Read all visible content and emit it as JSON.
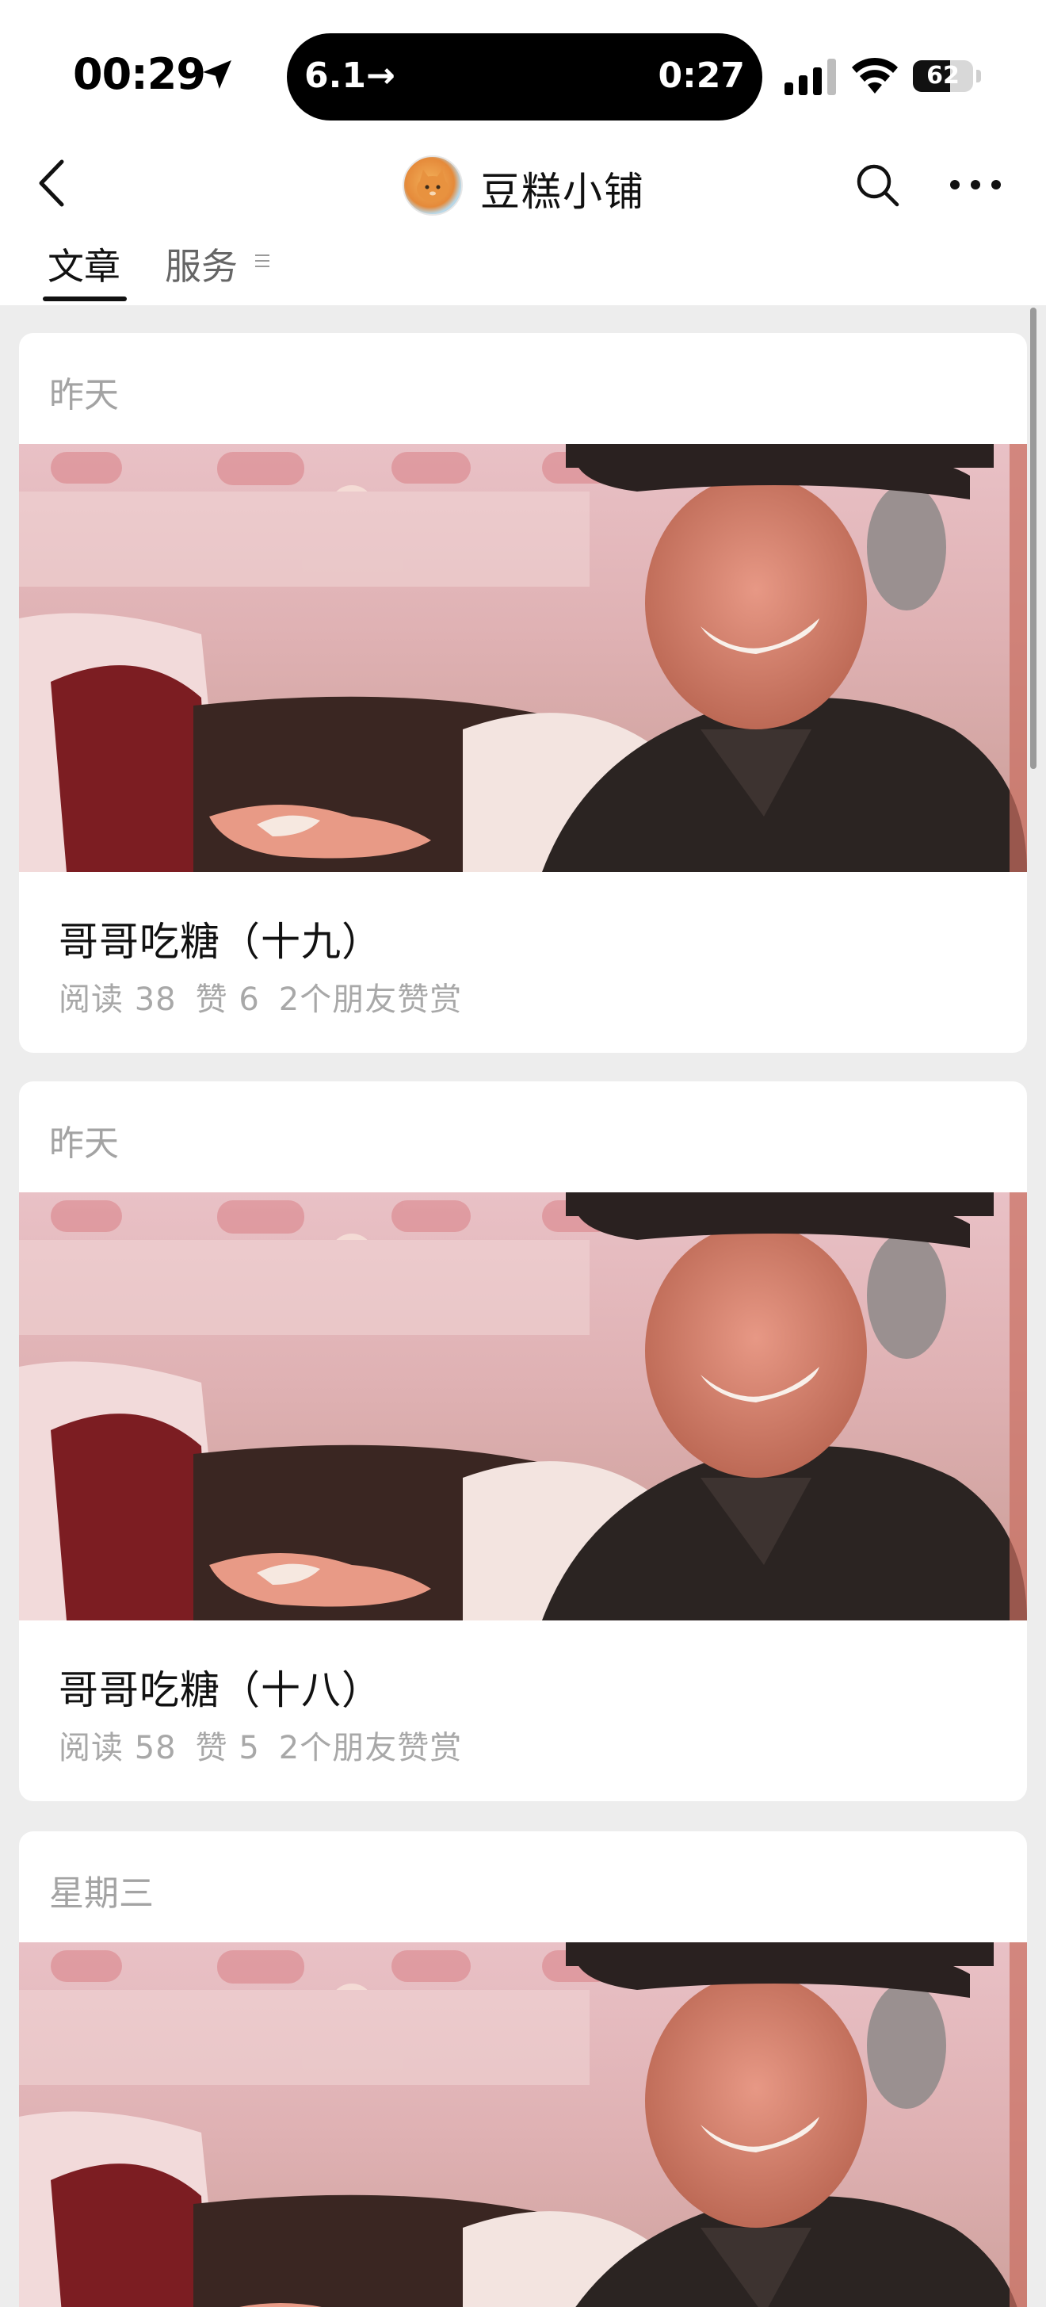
{
  "status_bar": {
    "time": "00:29",
    "island_left": "6.1→",
    "island_right": "0:27",
    "battery": "62",
    "battery_level": 0.62
  },
  "nav": {
    "title": "豆糕小铺",
    "avatar_icon": "cat-avatar",
    "back_icon": "chevron-left-icon",
    "search_icon": "search-icon",
    "more_icon": "more-horizontal-icon"
  },
  "tabs": [
    {
      "label": "文章",
      "active": true
    },
    {
      "label": "服务",
      "active": false,
      "icon": "menu-icon"
    }
  ],
  "articles": [
    {
      "date": "昨天",
      "title": "哥哥吃糖（十九）",
      "reads": "阅读 38",
      "likes": "赞 6",
      "tips": "2个朋友赞赏"
    },
    {
      "date": "昨天",
      "title": "哥哥吃糖（十八）",
      "reads": "阅读 58",
      "likes": "赞 5",
      "tips": "2个朋友赞赏"
    },
    {
      "date": "星期三",
      "title": "",
      "reads": "",
      "likes": "",
      "tips": ""
    }
  ]
}
